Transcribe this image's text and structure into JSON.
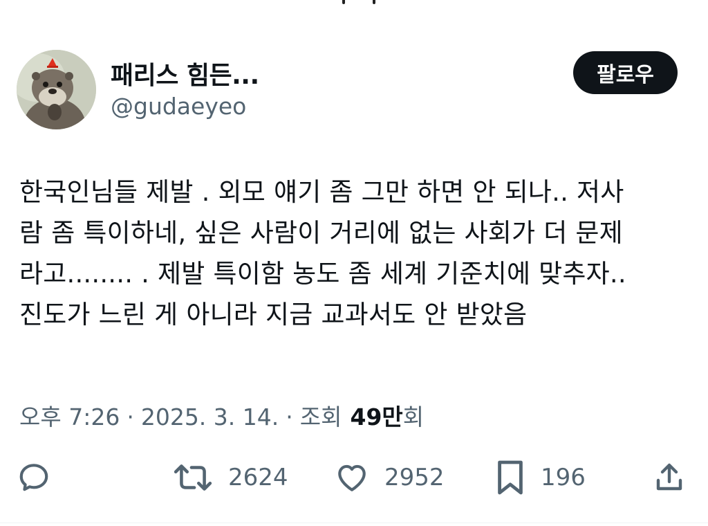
{
  "author": {
    "display_name": "패리스 힘든...",
    "handle": "@gudaeyeo",
    "follow_label": "팔로우"
  },
  "tweet": {
    "lines": [
      "한국인님들 제발 . 외모 얘기 좀 그만 하면 안 되나.. 저사",
      "람 좀 특이하네, 싶은 사람이 거리에 없는 사회가 더 문제",
      "라고........ . 제발 특이함 농도 좀 세계 기준치에 맞추자..",
      "진도가 느린 게 아니라 지금 교과서도 안 받았음"
    ]
  },
  "meta": {
    "time": "오후 7:26",
    "separator": "·",
    "date": "2025. 3. 14.",
    "views_label": "조회",
    "views_count": "49만",
    "views_suffix": "회"
  },
  "actions": {
    "reply_icon": "reply-icon",
    "retweet_icon": "retweet-icon",
    "retweet_count": "2624",
    "like_icon": "heart-icon",
    "like_count": "2952",
    "bookmark_icon": "bookmark-icon",
    "bookmark_count": "196",
    "share_icon": "share-icon"
  },
  "colors": {
    "text_primary": "#0f1419",
    "text_secondary": "#536471",
    "button_bg": "#0f1419",
    "button_text": "#ffffff"
  }
}
